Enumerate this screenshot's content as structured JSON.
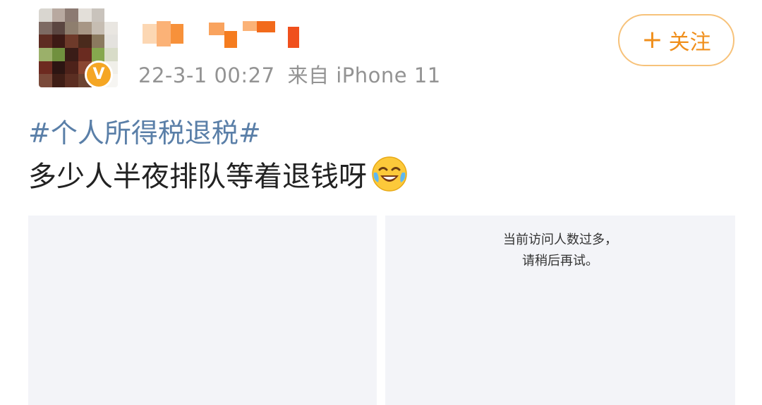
{
  "post": {
    "author_name_hidden": true,
    "verified_badge": "V",
    "timestamp": "22-3-1 00:27",
    "source": "来自 iPhone 11",
    "follow_label": "关注",
    "follow_plus": "+",
    "hashtag": "#个人所得税退税#",
    "text": "多少人半夜排队等着退钱呀",
    "emoji_icon": "crying-laughing-face-icon",
    "images": [
      {
        "message_lines": []
      },
      {
        "message_lines": [
          "当前访问人数过多，",
          "请稍后再试。"
        ]
      }
    ]
  },
  "colors": {
    "link_blue": "#5a7fa8",
    "accent_orange": "#f08f1c",
    "meta_gray": "#939393",
    "image_bg": "#f3f4f8"
  }
}
